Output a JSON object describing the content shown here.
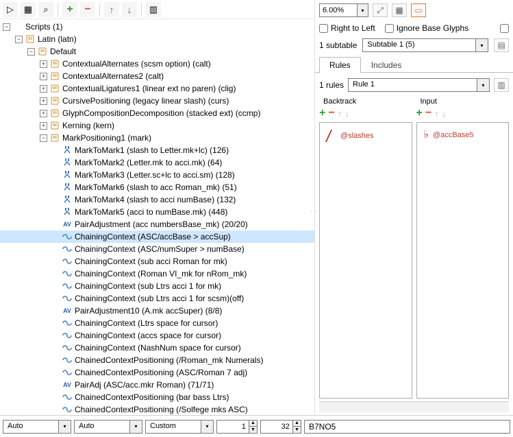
{
  "toolbar_left": {
    "btn_play": "▷",
    "btn_grid": "▦",
    "btn_find": "⌕",
    "btn_plus": "+",
    "btn_minus": "−",
    "btn_up": "↑",
    "btn_down": "↓",
    "btn_more": "▥"
  },
  "tree": {
    "root": {
      "exp": "−",
      "label": "Scripts (1)"
    },
    "latin": {
      "exp": "−",
      "label": "Latin (latn)"
    },
    "default": {
      "exp": "−",
      "label": "Default"
    },
    "lookups": [
      {
        "exp": "+",
        "type": "doc",
        "label": "ContextualAlternates (scsm option) (calt)"
      },
      {
        "exp": "+",
        "type": "doc",
        "label": "ContextualAlternates2 (calt)"
      },
      {
        "exp": "+",
        "type": "doc",
        "label": "ContextualLigatures1 (linear ext no paren) (clig)"
      },
      {
        "exp": "+",
        "type": "doc",
        "label": "CursivePositioning (legacy linear slash) (curs)"
      },
      {
        "exp": "+",
        "type": "doc",
        "label": "GlyphCompositionDecomposition (stacked ext) (ccmp)"
      },
      {
        "exp": "+",
        "type": "doc",
        "label": "Kerning (kern)"
      },
      {
        "exp": "−",
        "type": "doc",
        "label": "MarkPositioning1 (mark)"
      }
    ],
    "marks": [
      {
        "type": "mk",
        "label": "MarkToMark1 (slash to Letter.mk+lc) (126)"
      },
      {
        "type": "mk",
        "label": "MarkToMark2 (Letter.mk to acci.mk) (64)"
      },
      {
        "type": "mk",
        "label": "MarkToMark3 (Letter.sc+lc to acci.sm) (128)"
      },
      {
        "type": "mk",
        "label": "MarkToMark6 (slash to acc Roman_mk) (51)"
      },
      {
        "type": "mk",
        "label": "MarkToMark4 (slash to acci numBase) (132)"
      },
      {
        "type": "mk",
        "label": "MarkToMark5 (acci to numBase.mk) (448)"
      },
      {
        "type": "av",
        "label": "PairAdjustment (acc numbersBase_mk) (20/20)"
      },
      {
        "type": "cc",
        "label": "ChainingContext (ASC/accBase > accSup)",
        "selected": true
      },
      {
        "type": "cc",
        "label": "ChainingContext (ASC/numSuper > numBase)"
      },
      {
        "type": "cc",
        "label": "ChainingContext (sub acci Roman for mk)"
      },
      {
        "type": "cc",
        "label": "ChainingContext (Roman VI_mk for nRom_mk)"
      },
      {
        "type": "cc",
        "label": "ChainingContext (sub Ltrs acci 1 for mk)"
      },
      {
        "type": "cc",
        "label": "ChainingContext (sub Ltrs acci 1 for scsm)(off)"
      },
      {
        "type": "av",
        "label": "PairAdjustment10 (A.mk accSuper) (8/8)"
      },
      {
        "type": "cc",
        "label": "ChainingContext (Ltrs space for cursor)"
      },
      {
        "type": "cc",
        "label": "ChainingContext (accs space for cursor)"
      },
      {
        "type": "cc",
        "label": "ChainingContext (NashNum space for cursor)"
      },
      {
        "type": "cc",
        "label": "ChainedContextPositioning (/Roman_mk Numerals)"
      },
      {
        "type": "cc",
        "label": "ChainedContextPositioning (ASC/Roman 7 adj)"
      },
      {
        "type": "av",
        "label": "PairAdj (ASC/acc.mkr Roman) (71/71)"
      },
      {
        "type": "cc",
        "label": "ChainedContextPositioning (bar bass Ltrs)"
      },
      {
        "type": "cc",
        "label": "ChainedContextPositioning (/Solfege mks ASC)"
      }
    ]
  },
  "right": {
    "zoom": "6.00%",
    "rtl_label": "Right to Left",
    "ignore_label": "Ignore Base Glyphs",
    "subtable_count": "1 subtable",
    "subtable_value": "Subtable 1 (5)",
    "tabs": {
      "rules": "Rules",
      "includes": "Includes"
    },
    "rules_count": "1 rules",
    "rule_value": "Rule 1",
    "col_backtrack": "Backtrack",
    "col_input": "Input",
    "glyph_backtrack": "@slashes",
    "glyph_input": "@accBase5"
  },
  "bottom": {
    "auto1": "Auto",
    "auto2": "Auto",
    "custom": "Custom",
    "spin1": "1",
    "spin2": "32",
    "text": "B7NO5"
  }
}
